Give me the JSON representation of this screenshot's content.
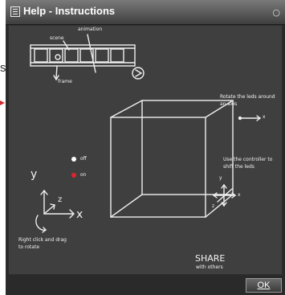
{
  "window": {
    "title": "Help - Instructions"
  },
  "background_fragment": {
    "text": "s"
  },
  "board": {
    "label_animation": "animation",
    "label_scene": "scene",
    "label_frame": "frame",
    "label_rotate": "Rotate the leds around an axis",
    "label_x1": "x",
    "label_controller": "Use the controller to shift the leds",
    "label_ctrl_y": "y",
    "label_ctrl_x": "x",
    "label_ctrl_z": "z",
    "label_off": "off",
    "label_on": "on",
    "label_axis_y": "y",
    "label_axis_z": "z",
    "label_axis_x": "x",
    "label_rightclick": "Right click and drag to rotate",
    "label_share": "SHARE",
    "label_share_sub": "with others"
  },
  "buttons": {
    "ok": "OK"
  },
  "colors": {
    "led_on": "#e0242b",
    "arrow": "#d6292e"
  }
}
